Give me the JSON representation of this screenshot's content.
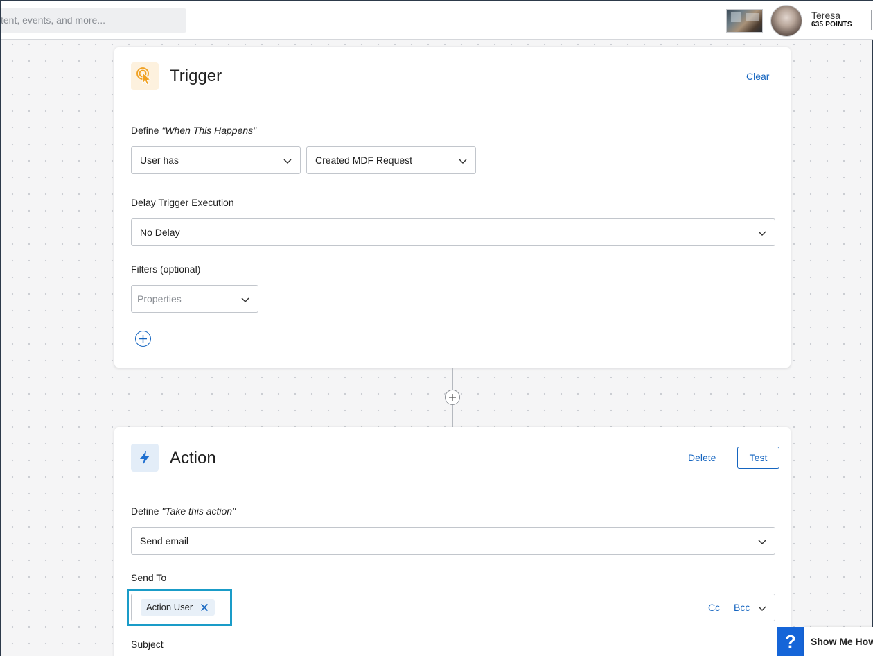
{
  "header": {
    "search_placeholder": "tent, events, and more...",
    "user_name": "Teresa",
    "user_points": "635 POINTS"
  },
  "trigger": {
    "title": "Trigger",
    "clear_label": "Clear",
    "define_prefix": "Define ",
    "define_quote": "\"When This Happens\"",
    "subject_select": "User has",
    "event_select": "Created MDF Request",
    "delay_label": "Delay Trigger Execution",
    "delay_select": "No Delay",
    "filters_label": "Filters (optional)",
    "properties_placeholder": "Properties"
  },
  "action": {
    "title": "Action",
    "delete_label": "Delete",
    "test_label": "Test",
    "define_prefix": "Define ",
    "define_quote": "\"Take this action\"",
    "action_select": "Send email",
    "send_to_label": "Send To",
    "recipient_chip": "Action User",
    "cc_label": "Cc",
    "bcc_label": "Bcc",
    "subject_label": "Subject"
  },
  "help": {
    "icon_glyph": "?",
    "label": "Show Me How"
  },
  "colors": {
    "accent": "#1565c0",
    "trigger_icon_bg": "#fdf1de",
    "trigger_icon": "#f0a020",
    "action_icon_bg": "#e3edf8",
    "action_icon": "#1e6fd0",
    "highlight": "#1a9cc8",
    "help_bg": "#1565d8"
  }
}
